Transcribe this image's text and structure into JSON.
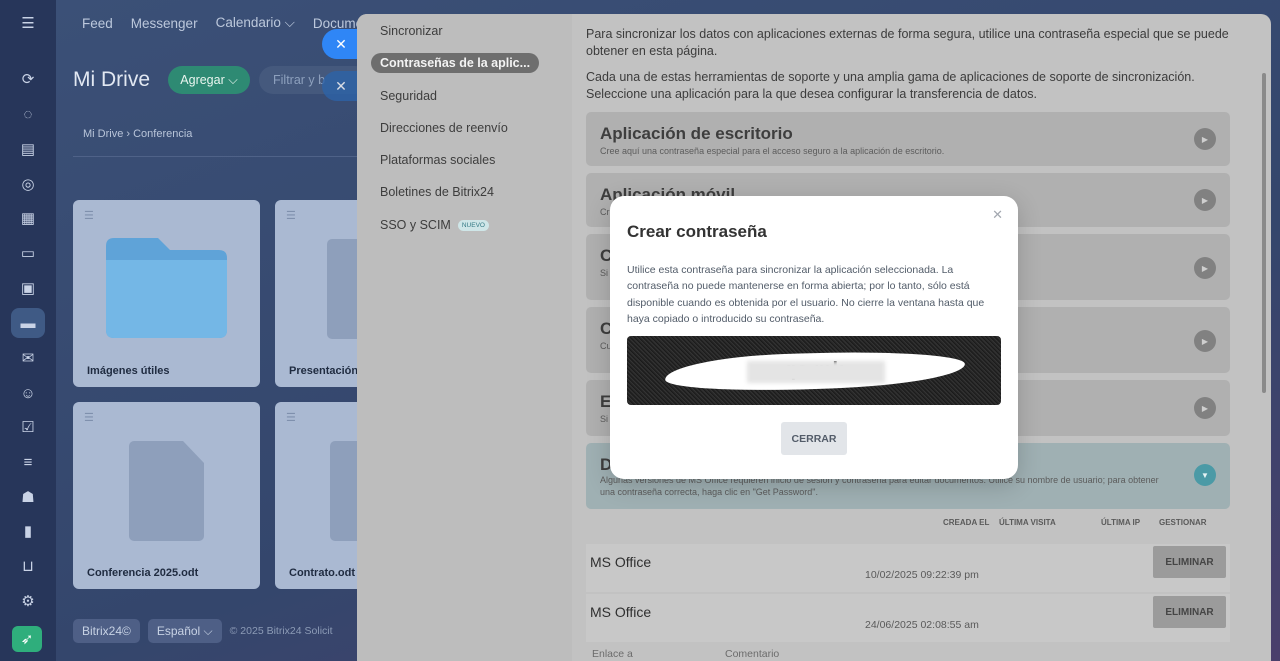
{
  "topnav": [
    "Feed",
    "Messenger",
    "Calendario ⌵",
    "Documen"
  ],
  "drive": {
    "title": "Mi Drive",
    "add_label": "Agregar ⌵",
    "filter_placeholder": "Filtrar y b",
    "breadcrumb": "Mi Drive   ›   Conferencia",
    "cards": [
      "Imágenes útiles",
      "Presentación_",
      "Conferencia 2025.odt",
      "Contrato.odt"
    ]
  },
  "footer": {
    "brand": "Bitrix24©",
    "language": "Español ⌵",
    "copyright": "© 2025 Bitrix24   Solicit"
  },
  "settings_nav": [
    "Sincronizar",
    "Contraseñas de la aplic...",
    "Seguridad",
    "Direcciones de reenvío",
    "Plataformas sociales",
    "Boletines de Bitrix24",
    "SSO y SCIM"
  ],
  "settings_nav_badge": "NUEVO",
  "intro": [
    "Para sincronizar los datos con aplicaciones externas de forma segura, utilice una contraseña especial que se puede obtener en esta página.",
    "Cada una de estas herramientas de soporte y una amplia gama de aplicaciones de soporte de sincronización. Seleccione una aplicación para la que desea configurar la transferencia de datos."
  ],
  "sections": [
    {
      "title": "Aplicación de escritorio",
      "desc": "Cree aquí una contraseña especial para el acceso seguro a la aplicación de escritorio."
    },
    {
      "title": "Aplicación móvil",
      "desc": "Cr"
    },
    {
      "title": "C",
      "desc": "Si                                                                                                                  Seleccione el objetivo de si"
    },
    {
      "title": "C",
      "desc": "Cu                                                                                                                  programas. Elija una de las op"
    },
    {
      "title": "E",
      "desc": "Si                                                                                                                  s."
    },
    {
      "title": "D",
      "desc": "Algunas versiones de MS Office requieren inicio de sesión y contraseña para editar documentos. Utilice su nombre de usuario; para obtener una contraseña correcta, haga clic en \"Get Password\"."
    }
  ],
  "table": {
    "headers": [
      "CREADA EL",
      "ÚLTIMA VISITA",
      "ÚLTIMA IP",
      "GESTIONAR"
    ],
    "rows": [
      {
        "name": "MS Office",
        "date": "10/02/2025 09:22:39 pm",
        "action": "ELIMINAR"
      },
      {
        "name": "MS Office",
        "date": "24/06/2025 02:08:55 am",
        "action": "ELIMINAR"
      }
    ],
    "bottom_labels": [
      "Enlace a",
      "Comentario"
    ]
  },
  "modal": {
    "title": "Crear contraseña",
    "text": "Utilice esta contraseña para sincronizar la aplicación seleccionada. La contraseña no puede mantenerse en forma abierta; por lo tanto, sólo está disponible cuando es obtenida por el usuario. No cierre la ventana hasta que haya copiado o introducido su contraseña.",
    "password": "qc              mk",
    "close_label": "CERRAR"
  },
  "colors": {
    "accent_green": "#2fae7c",
    "close_blue": "#2f86f6",
    "teal_open": "#4b9aa6"
  },
  "icons": [
    "menu-icon",
    "feed-icon",
    "chat-icon",
    "tasks-icon",
    "crm-icon",
    "calendar-icon",
    "docs-icon",
    "whiteboard-icon",
    "drive-icon",
    "mail-icon",
    "contacts-icon",
    "checklist-icon",
    "filter-icon",
    "robot-icon",
    "analytics-icon",
    "shop-icon",
    "settings-icon",
    "rocket-icon"
  ]
}
